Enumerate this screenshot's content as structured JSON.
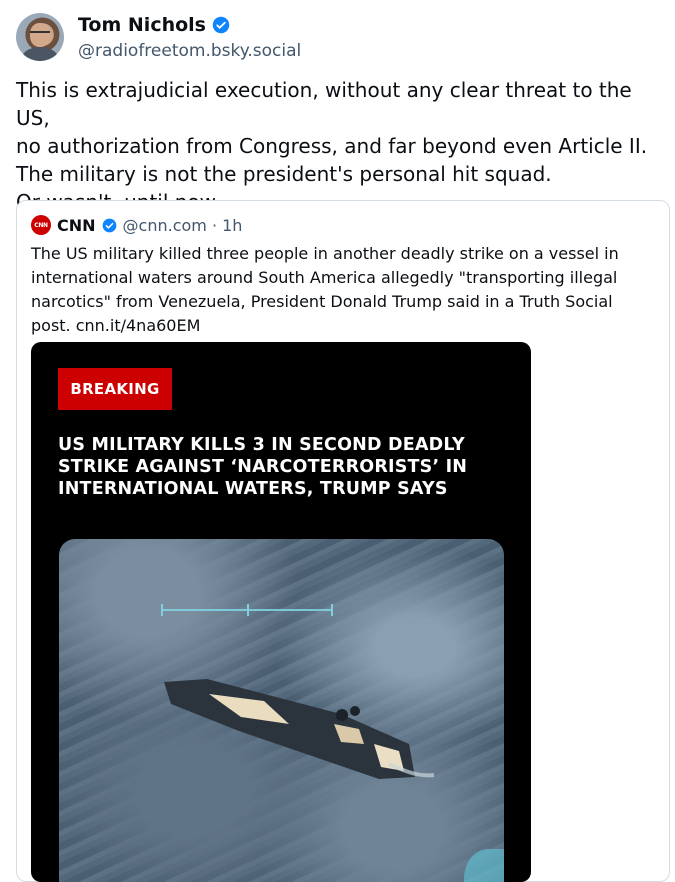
{
  "author": {
    "display_name": "Tom Nichols",
    "handle": "@radiofreetom.bsky.social",
    "avatar_icon": "avatar"
  },
  "post": {
    "text": "This is extrajudicial execution, without any clear threat to the US,\nno authorization from Congress, and far beyond even Article II.\nThe military is not the president's personal hit squad.\nOr wasn't, until now."
  },
  "quoted_post": {
    "logo_text": "CNN",
    "name": "CNN",
    "meta": "@cnn.com · 1h",
    "text": "The US military killed three people in another deadly strike on a vessel in international waters around South America allegedly \"transporting illegal narcotics\" from Venezuela, President Donald Trump said in a Truth Social post. cnn.it/4na60EM",
    "embed": {
      "badge": "BREAKING",
      "headline": "US MILITARY KILLS 3 IN SECOND DEADLY STRIKE AGAINST ‘NARCOTERRORISTS’ IN INTERNATIONAL WATERS, TRUMP SAYS"
    }
  },
  "colors": {
    "verified_blue": "#1083fe",
    "cnn_red": "#cc0000",
    "handle_gray": "#42576c"
  }
}
